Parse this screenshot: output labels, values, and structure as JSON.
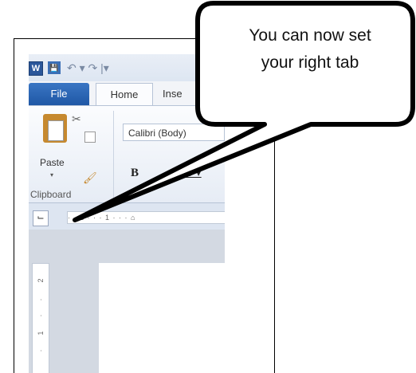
{
  "app": {
    "qat": {
      "word_icon": "W",
      "save_icon": "💾",
      "undo_icon": "↶ ▾ ↷ |▾"
    },
    "tabs": [
      {
        "label": "File"
      },
      {
        "label": "Home"
      },
      {
        "label": "Inse"
      }
    ],
    "ribbon": {
      "paste_label": "Paste",
      "paste_arrow": "▾",
      "font_name": "Calibri (Body)",
      "bold_label": "B",
      "underline_label": "U ▾",
      "group_clipboard": "Clipboard"
    },
    "ruler": {
      "tab_selector": "⌙",
      "horizontal_ticks": "· · 2 · · · 1 · · · ⌂",
      "vertical_ticks": [
        "2",
        "·",
        "·",
        "1",
        "·"
      ]
    }
  },
  "callout": {
    "text_line1": "You can now set",
    "text_line2": "your right tab"
  }
}
